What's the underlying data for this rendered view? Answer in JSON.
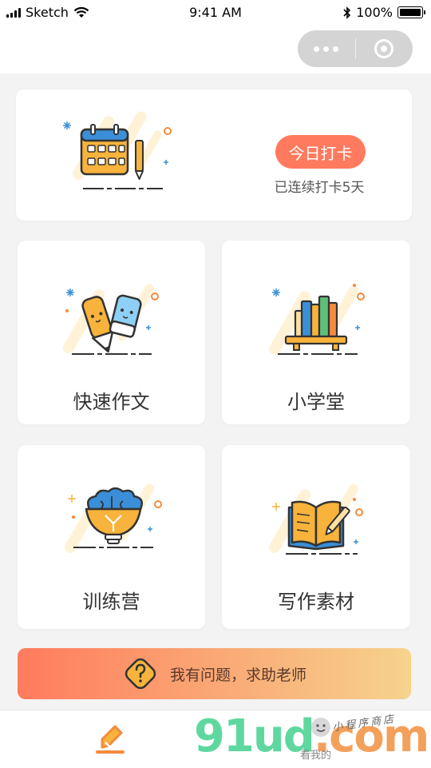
{
  "status_bar": {
    "carrier": "Sketch",
    "time": "9:41 AM",
    "battery": "100%"
  },
  "checkin": {
    "button_label": "今日打卡",
    "streak_text": "已连续打卡5天"
  },
  "tiles": [
    {
      "label": "快速作文",
      "icon": "pencil-eraser-icon"
    },
    {
      "label": "小学堂",
      "icon": "bookshelf-icon"
    },
    {
      "label": "训练营",
      "icon": "brain-bulb-icon"
    },
    {
      "label": "写作素材",
      "icon": "open-book-icon"
    }
  ],
  "help_banner": {
    "label": "我有问题，求助老师",
    "icon": "question-icon"
  },
  "tab_bar": {
    "active_icon": "writing-pen-icon"
  },
  "watermark": {
    "brand_part1": "91ud",
    "brand_part2": ".com",
    "slogan": "小程序商店",
    "small_text": "看我的"
  },
  "colors": {
    "accent": "#ff7a5e",
    "background": "#f3f3f3",
    "icon_yellow": "#f7b33b",
    "icon_blue": "#3a8fd8"
  }
}
